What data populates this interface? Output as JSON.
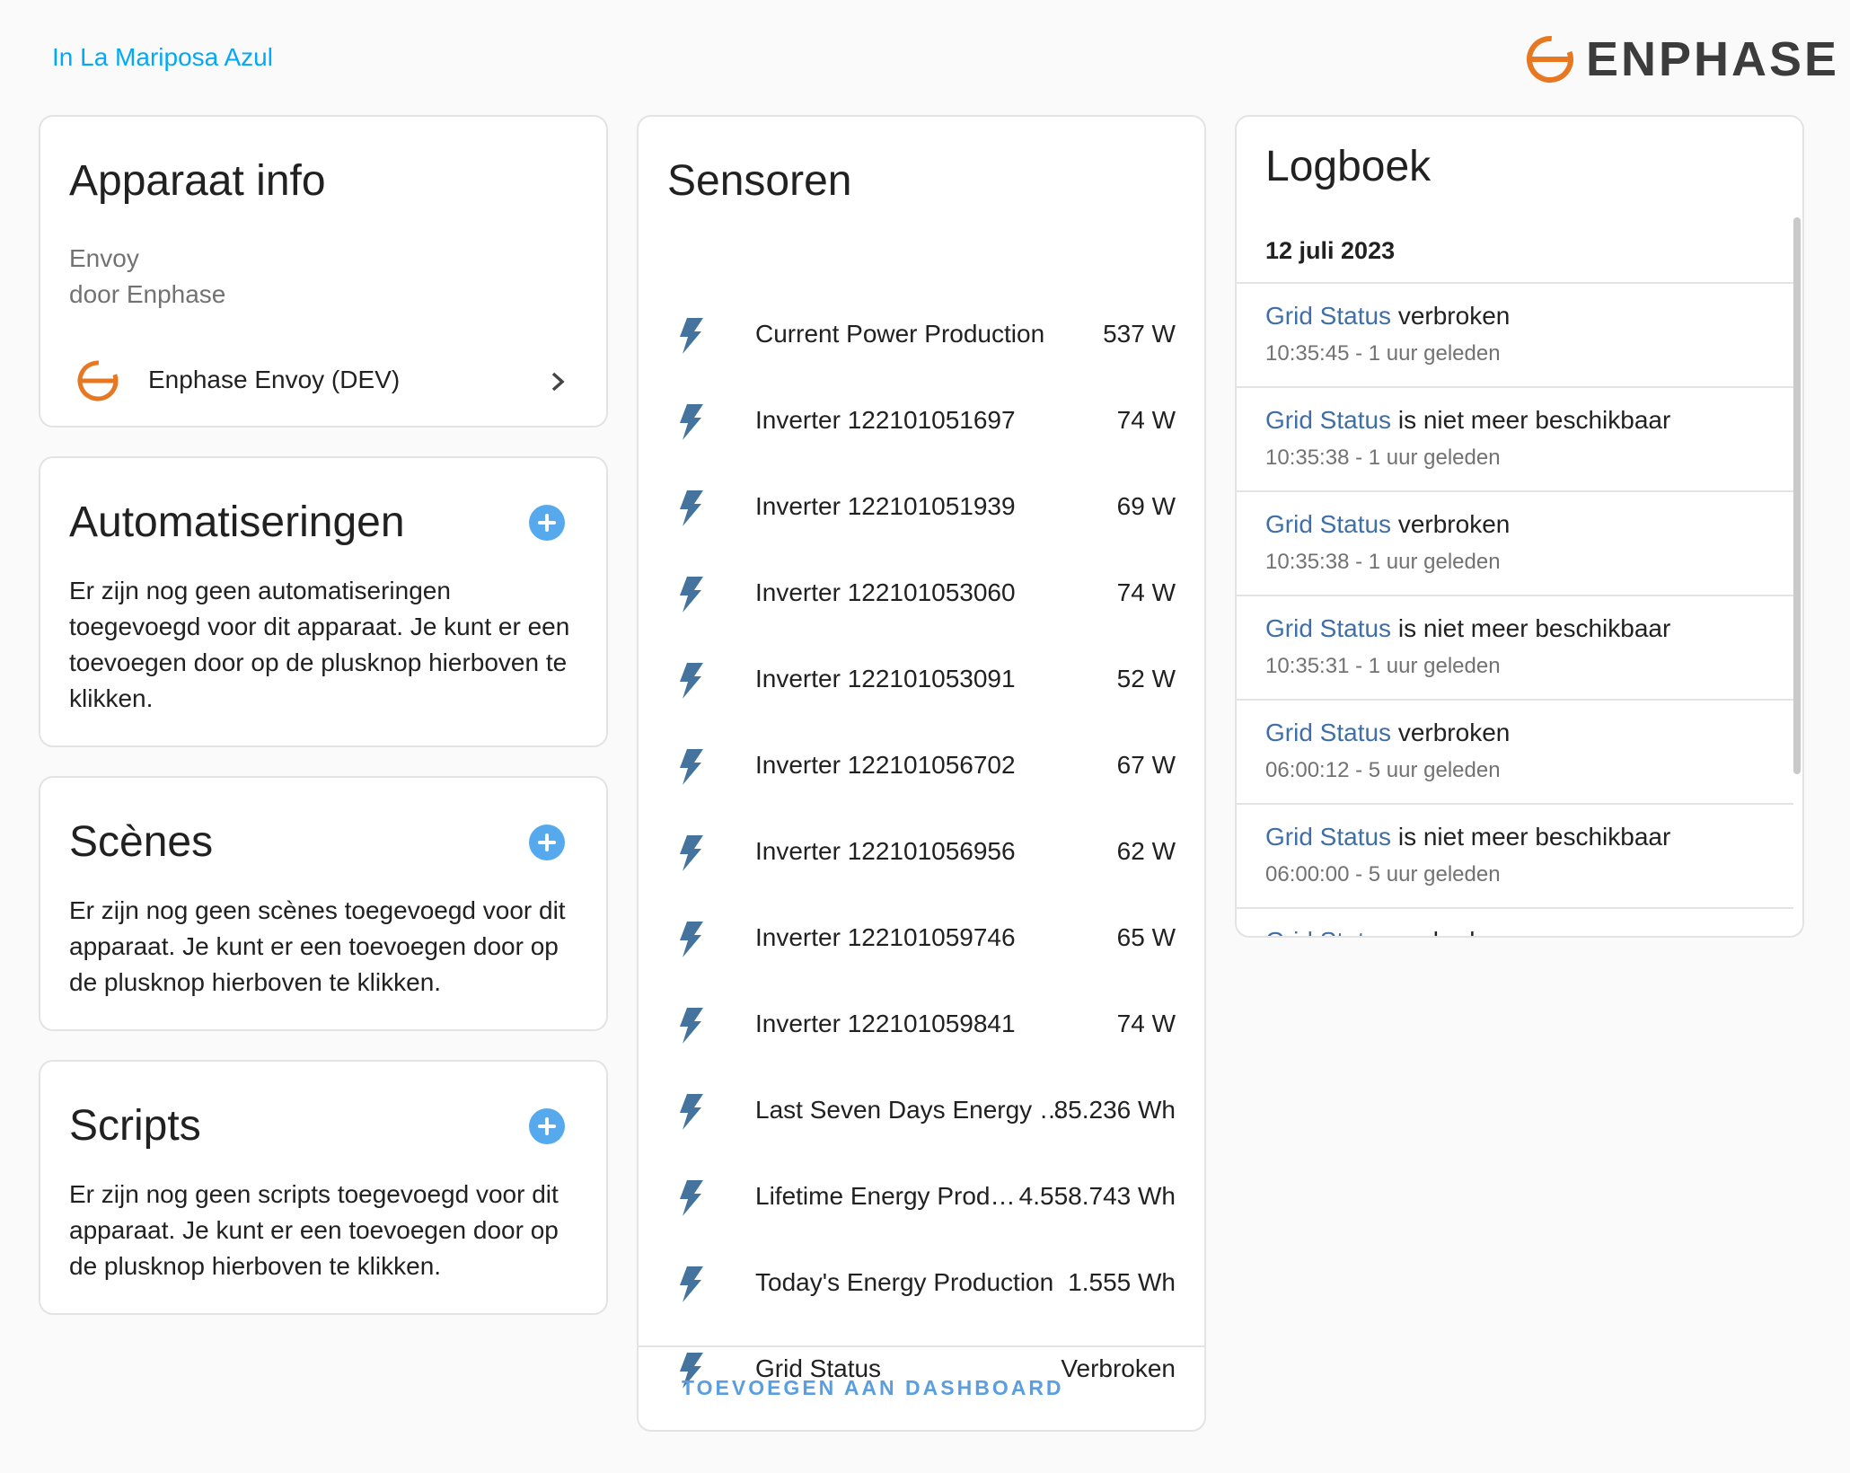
{
  "header": {
    "area_link": "In La Mariposa Azul",
    "brand": "ENPHASE",
    "brand_color": "#e87722"
  },
  "device_info": {
    "title": "Apparaat info",
    "model": "Envoy",
    "manufacturer": "door Enphase",
    "device_name": "Enphase Envoy (DEV)"
  },
  "automations": {
    "title": "Automatiseringen",
    "text_lines": [
      "Er zijn nog geen automatiseringen",
      "toegevoegd voor dit apparaat. Je kunt er een",
      "toevoegen door op de plusknop hierboven te",
      "klikken."
    ]
  },
  "scenes": {
    "title": "Scènes",
    "text_lines": [
      "Er zijn nog geen scènes toegevoegd voor dit",
      "apparaat. Je kunt er een toevoegen door op",
      "de plusknop hierboven te klikken."
    ]
  },
  "scripts": {
    "title": "Scripts",
    "text_lines": [
      "Er zijn nog geen scripts toegevoegd voor dit",
      "apparaat. Je kunt er een toevoegen door op",
      "de plusknop hierboven te klikken."
    ]
  },
  "sensors": {
    "title": "Sensoren",
    "items": [
      {
        "name": "Current Power Production",
        "value": "537 W"
      },
      {
        "name": "Inverter 122101051697",
        "value": "74 W"
      },
      {
        "name": "Inverter 122101051939",
        "value": "69 W"
      },
      {
        "name": "Inverter 122101053060",
        "value": "74 W"
      },
      {
        "name": "Inverter 122101053091",
        "value": "52 W"
      },
      {
        "name": "Inverter 122101056702",
        "value": "67 W"
      },
      {
        "name": "Inverter 122101056956",
        "value": "62 W"
      },
      {
        "name": "Inverter 122101059746",
        "value": "65 W"
      },
      {
        "name": "Inverter 122101059841",
        "value": "74 W"
      },
      {
        "name": "Last Seven Days Energy …",
        "value": "85.236 Wh"
      },
      {
        "name": "Lifetime Energy Prod…",
        "value": "4.558.743 Wh"
      },
      {
        "name": "Today's Energy Production",
        "value": "1.555 Wh"
      },
      {
        "name": "Grid Status",
        "value": "Verbroken"
      }
    ],
    "add_to_dashboard": "TOEVOEGEN AAN DASHBOARD",
    "icon": "flash-icon",
    "icon_color": "#44739e"
  },
  "logbook": {
    "title": "Logboek",
    "date": "12 juli 2023",
    "entries": [
      {
        "entity": "Grid Status",
        "message": " verbroken",
        "time": "10:35:45 - 1 uur geleden"
      },
      {
        "entity": "Grid Status",
        "message": " is niet meer beschikbaar",
        "time": "10:35:38 - 1 uur geleden"
      },
      {
        "entity": "Grid Status",
        "message": " verbroken",
        "time": "10:35:38 - 1 uur geleden"
      },
      {
        "entity": "Grid Status",
        "message": " is niet meer beschikbaar",
        "time": "10:35:31 - 1 uur geleden"
      },
      {
        "entity": "Grid Status",
        "message": " verbroken",
        "time": "06:00:12 - 5 uur geleden"
      },
      {
        "entity": "Grid Status",
        "message": " is niet meer beschikbaar",
        "time": "06:00:00 - 5 uur geleden"
      },
      {
        "entity": "Grid Status",
        "message": " verbroken",
        "time": ""
      }
    ]
  }
}
